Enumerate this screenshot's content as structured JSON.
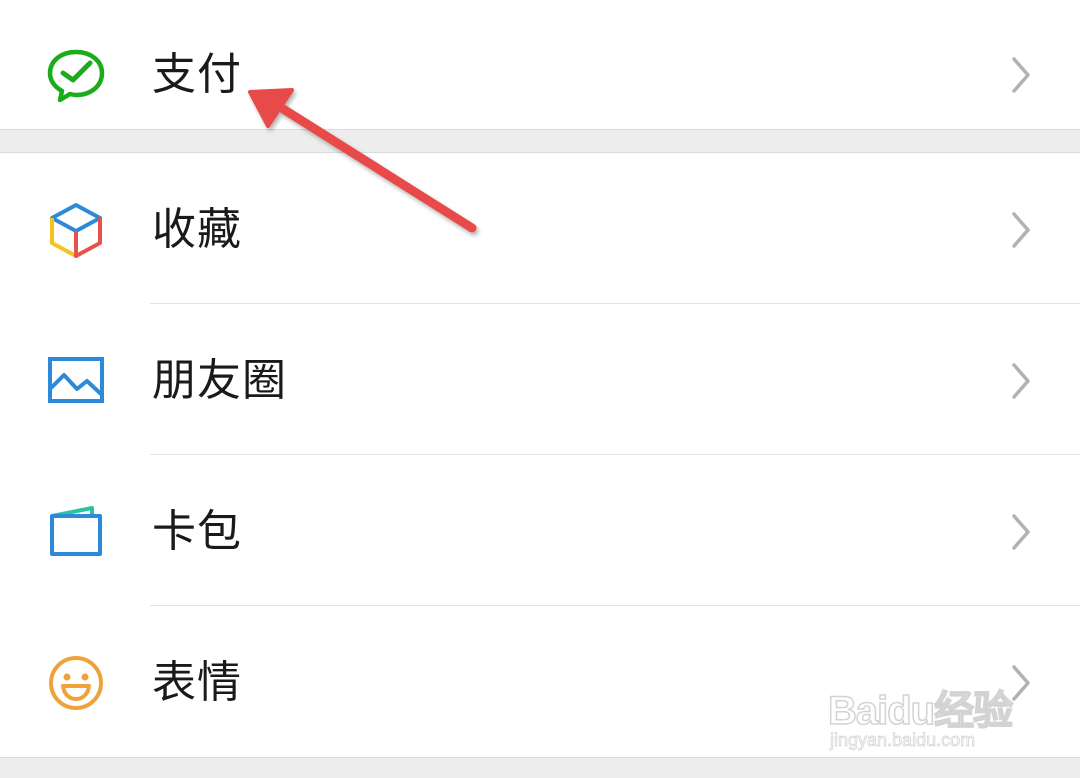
{
  "menu": {
    "pay": {
      "label": "支付",
      "icon": "wechat-pay-icon",
      "color": "#1aad19"
    },
    "items": [
      {
        "label": "收藏",
        "icon": "favorites-cube-icon"
      },
      {
        "label": "朋友圈",
        "icon": "moments-image-icon",
        "color": "#2c8ad8"
      },
      {
        "label": "卡包",
        "icon": "card-wallet-icon",
        "color": "#2c8ad8"
      },
      {
        "label": "表情",
        "icon": "smiley-face-icon",
        "color": "#f0a23a"
      }
    ]
  },
  "annotation": {
    "arrow_color": "#e84a4a"
  },
  "watermark": {
    "brand": "Baidu经验",
    "url": "jingyan.baidu.com"
  },
  "colors": {
    "background": "#ededed",
    "surface": "#ffffff",
    "text": "#1a1a1a",
    "chevron": "#b2b2b2"
  }
}
